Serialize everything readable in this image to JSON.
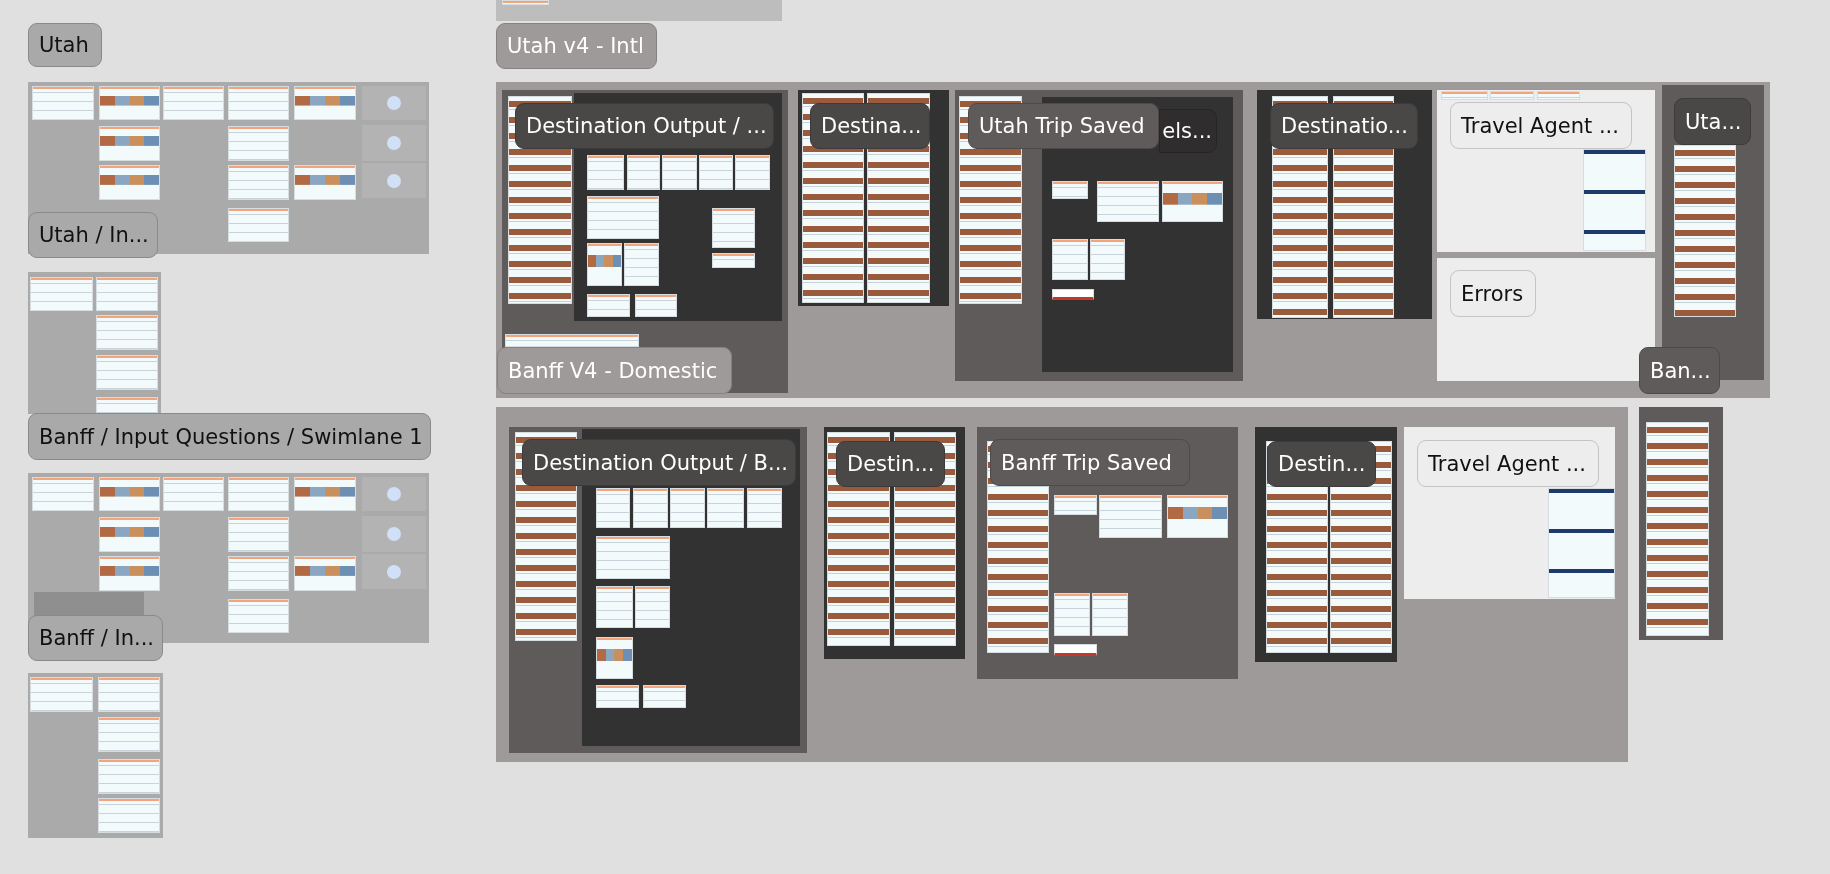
{
  "canvas_labels": [
    {
      "text": "Utah",
      "kind": "grey"
    },
    {
      "text": "Utah / In...",
      "kind": "grey"
    },
    {
      "text": "Banff / Input Questions / Swimlane 1",
      "kind": "grey"
    },
    {
      "text": "Banff / In...",
      "kind": "grey"
    },
    {
      "text": "Utah v4 - Intl",
      "kind": "mid"
    },
    {
      "text": "Destination Output / ...",
      "kind": "dark"
    },
    {
      "text": "Destina...",
      "kind": "dark"
    },
    {
      "text": "Utah Trip Saved",
      "kind": "section"
    },
    {
      "text": "els...",
      "kind": "darkest"
    },
    {
      "text": "Destinatio...",
      "kind": "dark"
    },
    {
      "text": "Travel Agent ...",
      "kind": "light"
    },
    {
      "text": "Uta...",
      "kind": "dark"
    },
    {
      "text": "Errors",
      "kind": "light"
    },
    {
      "text": "Banff V4 - Domestic",
      "kind": "mid"
    },
    {
      "text": "Ban...",
      "kind": "section"
    },
    {
      "text": "Destination Output / B...",
      "kind": "dark"
    },
    {
      "text": "Destin...",
      "kind": "dark"
    },
    {
      "text": "Banff Trip Saved",
      "kind": "section"
    },
    {
      "text": "Destin...",
      "kind": "dark"
    },
    {
      "text": "Travel Agent ...",
      "kind": "light"
    }
  ]
}
